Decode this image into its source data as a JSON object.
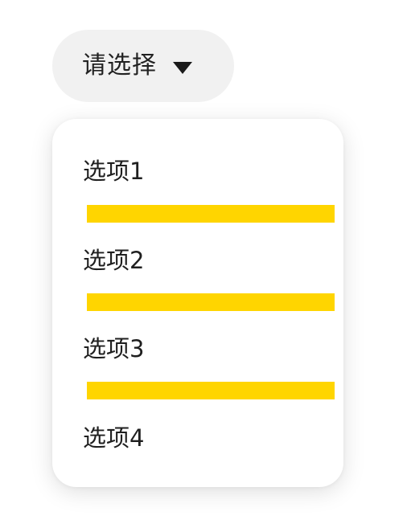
{
  "select": {
    "placeholder": "请选择",
    "caret_icon": "caret-down-icon"
  },
  "menu": {
    "options": [
      {
        "label": "选项1"
      },
      {
        "label": "选项2"
      },
      {
        "label": "选项3"
      },
      {
        "label": "选项4"
      }
    ],
    "divider_color": "#FFD500"
  },
  "colors": {
    "trigger_bg": "#F1F1F1",
    "text": "#222222",
    "menu_bg": "#FFFFFF",
    "divider": "#FFD500"
  }
}
